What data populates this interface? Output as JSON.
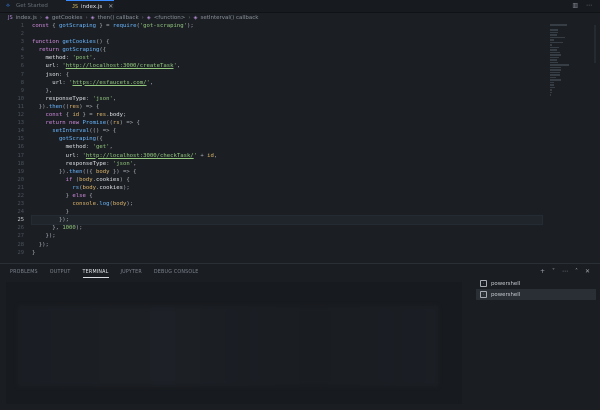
{
  "tabs": [
    {
      "label": "Get Started",
      "icon": "vscode-icon"
    },
    {
      "label": "index.js",
      "icon": "js-icon",
      "active": true
    }
  ],
  "breadcrumb": [
    "index.js",
    "getCookies",
    "then() callback",
    "<function>",
    "setInterval() callback"
  ],
  "editor": {
    "current_line": 25,
    "lines": [
      {
        "n": "1",
        "t": [
          [
            "kw",
            "const "
          ],
          [
            "pun",
            "{ "
          ],
          [
            "fn",
            "gotScraping"
          ],
          [
            "pun",
            " } = "
          ],
          [
            "fn",
            "require"
          ],
          [
            "pun",
            "("
          ],
          [
            "str",
            "'got-scraping'"
          ],
          [
            "pun",
            ");"
          ]
        ]
      },
      {
        "n": "2",
        "t": []
      },
      {
        "n": "3",
        "t": [
          [
            "kw",
            "function "
          ],
          [
            "fn",
            "getCookies"
          ],
          [
            "pun",
            "() {"
          ]
        ]
      },
      {
        "n": "4",
        "t": [
          [
            "pun",
            "  "
          ],
          [
            "kw",
            "return "
          ],
          [
            "fn",
            "gotScraping"
          ],
          [
            "pun",
            "({"
          ]
        ]
      },
      {
        "n": "5",
        "t": [
          [
            "prop",
            "    method"
          ],
          [
            "pun",
            ": "
          ],
          [
            "str",
            "'post'"
          ],
          [
            "pun",
            ","
          ]
        ]
      },
      {
        "n": "6",
        "t": [
          [
            "prop",
            "    url"
          ],
          [
            "pun",
            ": "
          ],
          [
            "str",
            "'"
          ],
          [
            "url",
            "http://localhost:3000/createTask"
          ],
          [
            "str",
            "'"
          ],
          [
            "pun",
            ","
          ]
        ]
      },
      {
        "n": "7",
        "t": [
          [
            "prop",
            "    json"
          ],
          [
            "pun",
            ": {"
          ]
        ]
      },
      {
        "n": "8",
        "t": [
          [
            "prop",
            "      url"
          ],
          [
            "pun",
            ": "
          ],
          [
            "str",
            "'"
          ],
          [
            "url",
            "https://esfaucets.com/"
          ],
          [
            "str",
            "'"
          ],
          [
            "pun",
            ","
          ]
        ]
      },
      {
        "n": "9",
        "t": [
          [
            "pun",
            "    },"
          ]
        ]
      },
      {
        "n": "10",
        "t": [
          [
            "prop",
            "    responseType"
          ],
          [
            "pun",
            ": "
          ],
          [
            "str",
            "'json'"
          ],
          [
            "pun",
            ","
          ]
        ]
      },
      {
        "n": "11",
        "t": [
          [
            "pun",
            "  })."
          ],
          [
            "fn",
            "then"
          ],
          [
            "pun",
            "(("
          ],
          [
            "var",
            "res"
          ],
          [
            "pun",
            ") => {"
          ]
        ]
      },
      {
        "n": "12",
        "t": [
          [
            "kw",
            "    const "
          ],
          [
            "pun",
            "{ "
          ],
          [
            "var",
            "id"
          ],
          [
            "pun",
            " } = "
          ],
          [
            "var",
            "res"
          ],
          [
            "pun",
            "."
          ],
          [
            "prop",
            "body"
          ],
          [
            "pun",
            ";"
          ]
        ]
      },
      {
        "n": "13",
        "t": [
          [
            "kw",
            "    return new "
          ],
          [
            "fn",
            "Promise"
          ],
          [
            "pun",
            "(("
          ],
          [
            "var",
            "rs"
          ],
          [
            "pun",
            ") => {"
          ]
        ]
      },
      {
        "n": "14",
        "t": [
          [
            "fn",
            "      setInterval"
          ],
          [
            "pun",
            "(() => {"
          ]
        ]
      },
      {
        "n": "15",
        "t": [
          [
            "fn",
            "        gotScraping"
          ],
          [
            "pun",
            "({"
          ]
        ]
      },
      {
        "n": "16",
        "t": [
          [
            "prop",
            "          method"
          ],
          [
            "pun",
            ": "
          ],
          [
            "str",
            "'get'"
          ],
          [
            "pun",
            ","
          ]
        ]
      },
      {
        "n": "17",
        "t": [
          [
            "prop",
            "          url"
          ],
          [
            "pun",
            ": "
          ],
          [
            "str",
            "'"
          ],
          [
            "url",
            "http://localhost:3000/checkTask/"
          ],
          [
            "str",
            "'"
          ],
          [
            "pun",
            " + "
          ],
          [
            "var",
            "id"
          ],
          [
            "pun",
            ","
          ]
        ]
      },
      {
        "n": "18",
        "t": [
          [
            "prop",
            "          responseType"
          ],
          [
            "pun",
            ": "
          ],
          [
            "str",
            "'json'"
          ],
          [
            "pun",
            ","
          ]
        ]
      },
      {
        "n": "19",
        "t": [
          [
            "pun",
            "        })."
          ],
          [
            "fn",
            "then"
          ],
          [
            "pun",
            "(({ "
          ],
          [
            "var",
            "body"
          ],
          [
            "pun",
            " }) => {"
          ]
        ]
      },
      {
        "n": "20",
        "t": [
          [
            "kw",
            "          if "
          ],
          [
            "pun",
            "("
          ],
          [
            "var",
            "body"
          ],
          [
            "pun",
            "."
          ],
          [
            "prop",
            "cookies"
          ],
          [
            "pun",
            ") {"
          ]
        ]
      },
      {
        "n": "21",
        "t": [
          [
            "fn",
            "            rs"
          ],
          [
            "pun",
            "("
          ],
          [
            "var",
            "body"
          ],
          [
            "pun",
            "."
          ],
          [
            "prop",
            "cookies"
          ],
          [
            "pun",
            ");"
          ]
        ]
      },
      {
        "n": "22",
        "t": [
          [
            "pun",
            "          } "
          ],
          [
            "kw",
            "else "
          ],
          [
            "pun",
            "{"
          ]
        ]
      },
      {
        "n": "23",
        "t": [
          [
            "var",
            "            console"
          ],
          [
            "pun",
            "."
          ],
          [
            "fn",
            "log"
          ],
          [
            "pun",
            "("
          ],
          [
            "var",
            "body"
          ],
          [
            "pun",
            ");"
          ]
        ]
      },
      {
        "n": "24",
        "t": [
          [
            "pun",
            "          }"
          ]
        ]
      },
      {
        "n": "25",
        "t": [
          [
            "pun",
            "        });"
          ]
        ]
      },
      {
        "n": "26",
        "t": [
          [
            "pun",
            "      }, "
          ],
          [
            "str",
            "1000"
          ],
          [
            "pun",
            ");"
          ]
        ]
      },
      {
        "n": "27",
        "t": [
          [
            "pun",
            "    });"
          ]
        ]
      },
      {
        "n": "28",
        "t": [
          [
            "pun",
            "  });"
          ]
        ]
      },
      {
        "n": "29",
        "t": [
          [
            "pun",
            "}"
          ]
        ]
      }
    ]
  },
  "panel": {
    "tabs": [
      "PROBLEMS",
      "OUTPUT",
      "TERMINAL",
      "JUPYTER",
      "DEBUG CONSOLE"
    ],
    "active_tab": "TERMINAL",
    "actions": [
      "+",
      "˅",
      "⋯",
      "˄",
      "✕"
    ],
    "sessions": [
      {
        "label": "powershell",
        "active": false
      },
      {
        "label": "powershell",
        "active": true
      }
    ]
  }
}
